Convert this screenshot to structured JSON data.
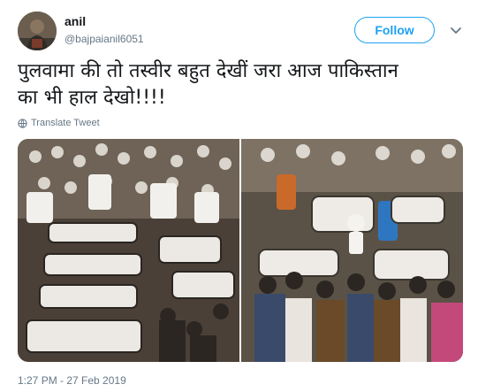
{
  "user": {
    "display_name": "anil",
    "handle": "@bajpaianil6051",
    "avatar_icon": "profile-photo"
  },
  "actions": {
    "follow_label": "Follow",
    "menu_icon": "chevron-down-icon"
  },
  "tweet": {
    "text_line1": "पुलवामा की तो तस्वीर बहुत देखीं जरा आज पाकिस्तान",
    "text_line2": "का भी हाल देखो!!!!",
    "translate_label": "Translate Tweet",
    "timestamp": "1:27 PM - 27 Feb 2019"
  },
  "colors": {
    "accent": "#1da1f2",
    "secondary_text": "#657786",
    "primary_text": "#14171a"
  }
}
